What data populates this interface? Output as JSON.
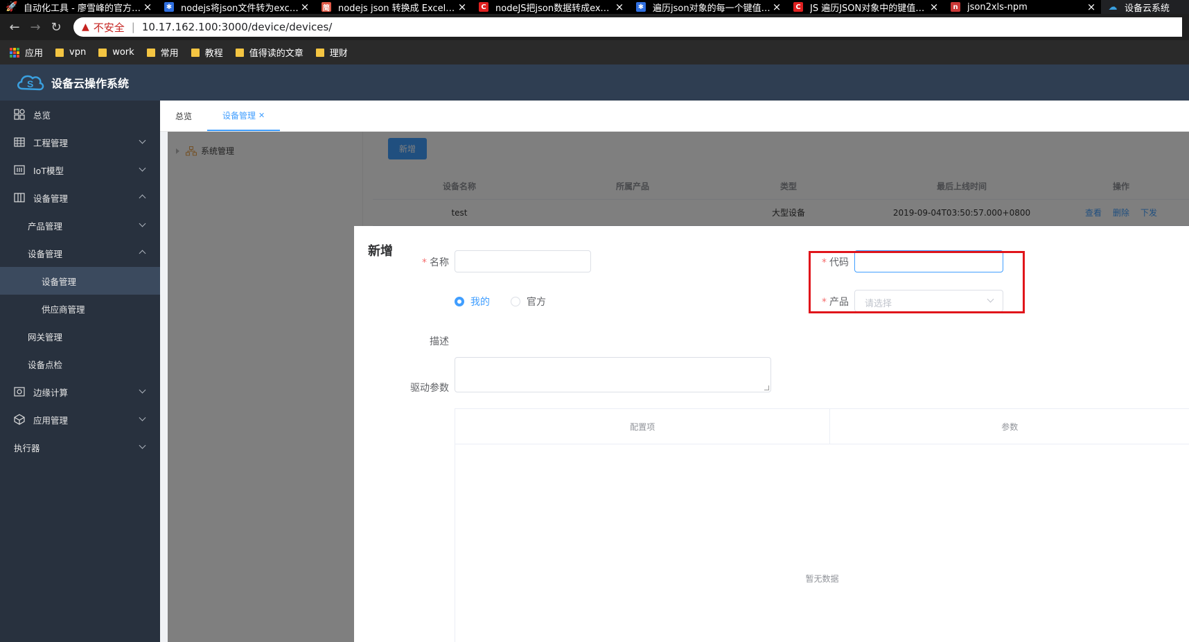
{
  "browser": {
    "tabs": [
      {
        "title": "自动化工具 - 廖雪峰的官方网站",
        "icon": "rocket-icon",
        "icon_color": "#4aa3ff"
      },
      {
        "title": "nodejs将json文件转为excel、",
        "icon": "baidu-paw-icon",
        "icon_color": "#2f6fe0"
      },
      {
        "title": "nodejs json 转换成 Excel 支持",
        "icon": "jianshu-icon",
        "icon_color": "#e05a48"
      },
      {
        "title": "nodeJS把json数据转成excel（",
        "icon": "csdn-icon",
        "icon_color": "#e02020"
      },
      {
        "title": "遍历json对象的每一个键值对_",
        "icon": "baidu-paw-icon",
        "icon_color": "#2f6fe0"
      },
      {
        "title": "JS 遍历JSON对象中的键值对_",
        "icon": "csdn-icon",
        "icon_color": "#e02020"
      },
      {
        "title": "json2xls-npm",
        "icon": "npm-icon",
        "icon_color": "#cb3837"
      },
      {
        "title": "设备云系统",
        "icon": "cloud-icon",
        "icon_color": "#3aa0e0"
      }
    ],
    "security_label": "不安全",
    "url": "10.17.162.100:3000/device/devices/",
    "bookmarks": [
      "应用",
      "vpn",
      "work",
      "常用",
      "教程",
      "值得读的文章",
      "理财"
    ]
  },
  "app": {
    "title": "设备云操作系统"
  },
  "sidebar": {
    "items": [
      {
        "label": "总览",
        "icon": "dashboard-icon"
      },
      {
        "label": "工程管理",
        "icon": "building-icon"
      },
      {
        "label": "IoT模型",
        "icon": "iot-model-icon"
      },
      {
        "label": "设备管理",
        "icon": "columns-icon"
      },
      {
        "label": "产品管理"
      },
      {
        "label": "设备管理"
      },
      {
        "label": "设备管理"
      },
      {
        "label": "供应商管理"
      },
      {
        "label": "网关管理"
      },
      {
        "label": "设备点检"
      },
      {
        "label": "边缘计算",
        "icon": "edge-camera-icon"
      },
      {
        "label": "应用管理",
        "icon": "cube-icon"
      },
      {
        "label": "执行器"
      }
    ]
  },
  "page_tabs": [
    {
      "label": "总览"
    },
    {
      "label": "设备管理"
    }
  ],
  "tree": {
    "root": "系统管理"
  },
  "list": {
    "add_button": "新增",
    "columns": [
      "设备名称",
      "所属产品",
      "类型",
      "最后上线时间",
      "操作"
    ],
    "rows": [
      {
        "name": "test",
        "product": "",
        "type": "大型设备",
        "last_online": "2019-09-04T03:50:57.000+0800",
        "actions": [
          "查看",
          "删除",
          "下发"
        ]
      }
    ]
  },
  "dialog": {
    "title": "新增",
    "name_label": "名称",
    "name_value": "",
    "code_label": "代码",
    "code_value": "",
    "radio_options": [
      "我的",
      "官方"
    ],
    "radio_selected": "我的",
    "product_label": "产品",
    "product_placeholder": "请选择",
    "desc_label": "描述",
    "params_label": "驱动参数",
    "params_columns": [
      "配置项",
      "参数"
    ],
    "empty_text": "暂无数据"
  },
  "colors": {
    "primary": "#409eff",
    "sidebar_bg": "#28313e",
    "header_bg": "#2f3e52",
    "highlight": "#e0151b"
  }
}
